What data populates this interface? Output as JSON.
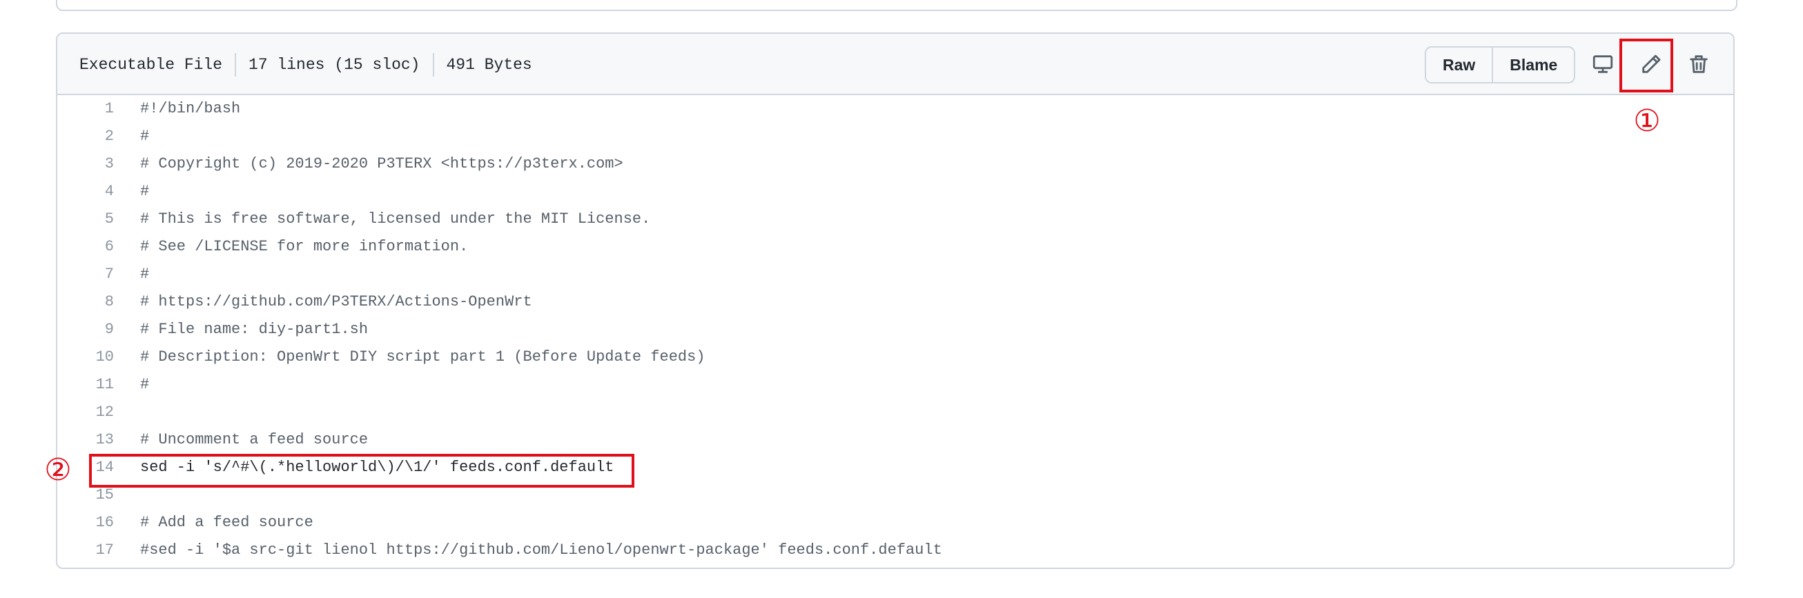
{
  "file_info": {
    "type": "Executable File",
    "lines": "17 lines (15 sloc)",
    "size": "491 Bytes"
  },
  "toolbar": {
    "raw_label": "Raw",
    "blame_label": "Blame",
    "icons": [
      "desktop-icon",
      "pencil-icon",
      "trash-icon"
    ]
  },
  "code": {
    "lines": [
      {
        "num": "1",
        "text": "#!/bin/bash"
      },
      {
        "num": "2",
        "text": "#"
      },
      {
        "num": "3",
        "text": "# Copyright (c) 2019-2020 P3TERX <https://p3terx.com>"
      },
      {
        "num": "4",
        "text": "#"
      },
      {
        "num": "5",
        "text": "# This is free software, licensed under the MIT License."
      },
      {
        "num": "6",
        "text": "# See /LICENSE for more information."
      },
      {
        "num": "7",
        "text": "#"
      },
      {
        "num": "8",
        "text": "# https://github.com/P3TERX/Actions-OpenWrt"
      },
      {
        "num": "9",
        "text": "# File name: diy-part1.sh"
      },
      {
        "num": "10",
        "text": "# Description: OpenWrt DIY script part 1 (Before Update feeds)"
      },
      {
        "num": "11",
        "text": "#"
      },
      {
        "num": "12",
        "text": ""
      },
      {
        "num": "13",
        "text": "# Uncomment a feed source"
      },
      {
        "num": "14",
        "text": "sed -i 's/^#\\(.*helloworld\\)/\\1/' feeds.conf.default"
      },
      {
        "num": "15",
        "text": ""
      },
      {
        "num": "16",
        "text": "# Add a feed source"
      },
      {
        "num": "17",
        "text": "#sed -i '$a src-git lienol https://github.com/Lienol/openwrt-package' feeds.conf.default"
      }
    ]
  },
  "annotations": {
    "one": "①",
    "two": "②",
    "color": "#e0101a"
  }
}
